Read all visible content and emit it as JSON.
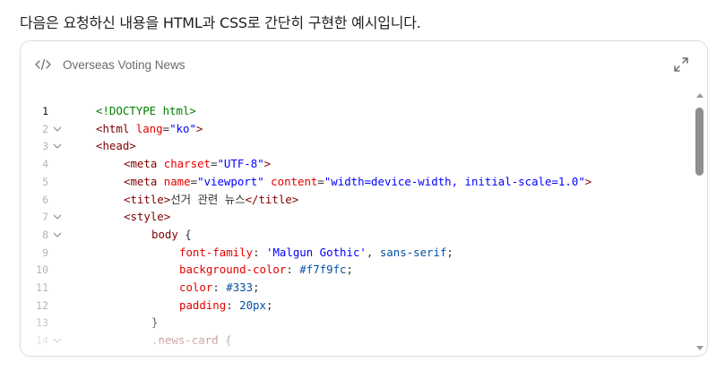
{
  "intro_text": "다음은 요청하신 내용을 HTML과 CSS로 간단히 구현한 예시입니다.",
  "artifact": {
    "title": "Overseas Voting News",
    "code_icon": "code-icon",
    "expand_icon": "expand-icon"
  },
  "code_lines": [
    {
      "n": "1",
      "fold": false,
      "active": true,
      "indent": 0,
      "tokens": [
        [
          "doctype",
          "<!DOCTYPE html>"
        ]
      ]
    },
    {
      "n": "2",
      "fold": true,
      "active": false,
      "indent": 0,
      "tokens": [
        [
          "tag",
          "<html "
        ],
        [
          "attr",
          "lang"
        ],
        [
          "punc",
          "="
        ],
        [
          "str",
          "\"ko\""
        ],
        [
          "tag",
          ">"
        ]
      ]
    },
    {
      "n": "3",
      "fold": true,
      "active": false,
      "indent": 0,
      "tokens": [
        [
          "tag",
          "<head>"
        ]
      ]
    },
    {
      "n": "4",
      "fold": false,
      "active": false,
      "indent": 1,
      "tokens": [
        [
          "tag",
          "<meta "
        ],
        [
          "attr",
          "charset"
        ],
        [
          "punc",
          "="
        ],
        [
          "str",
          "\"UTF-8\""
        ],
        [
          "tag",
          ">"
        ]
      ]
    },
    {
      "n": "5",
      "fold": false,
      "active": false,
      "indent": 1,
      "tokens": [
        [
          "tag",
          "<meta "
        ],
        [
          "attr",
          "name"
        ],
        [
          "punc",
          "="
        ],
        [
          "str",
          "\"viewport\""
        ],
        [
          "punc",
          " "
        ],
        [
          "attr",
          "content"
        ],
        [
          "punc",
          "="
        ],
        [
          "str",
          "\"width=device-width, initial-scale=1.0\""
        ],
        [
          "tag",
          ">"
        ]
      ]
    },
    {
      "n": "6",
      "fold": false,
      "active": false,
      "indent": 1,
      "tokens": [
        [
          "tag",
          "<title>"
        ],
        [
          "punc",
          "선거 관련 뉴스"
        ],
        [
          "tag",
          "</title>"
        ]
      ]
    },
    {
      "n": "7",
      "fold": true,
      "active": false,
      "indent": 1,
      "tokens": [
        [
          "tag",
          "<style>"
        ]
      ]
    },
    {
      "n": "8",
      "fold": true,
      "active": false,
      "indent": 2,
      "tokens": [
        [
          "sel",
          "body"
        ],
        [
          "punc",
          " {"
        ]
      ]
    },
    {
      "n": "9",
      "fold": false,
      "active": false,
      "indent": 3,
      "tokens": [
        [
          "prop",
          "font-family"
        ],
        [
          "punc",
          ": "
        ],
        [
          "str",
          "'Malgun Gothic'"
        ],
        [
          "punc",
          ", "
        ],
        [
          "cssval",
          "sans-serif"
        ],
        [
          "punc",
          ";"
        ]
      ]
    },
    {
      "n": "10",
      "fold": false,
      "active": false,
      "indent": 3,
      "tokens": [
        [
          "prop",
          "background-color"
        ],
        [
          "punc",
          ": "
        ],
        [
          "cssval",
          "#f7f9fc"
        ],
        [
          "punc",
          ";"
        ]
      ]
    },
    {
      "n": "11",
      "fold": false,
      "active": false,
      "indent": 3,
      "tokens": [
        [
          "prop",
          "color"
        ],
        [
          "punc",
          ": "
        ],
        [
          "cssval",
          "#333"
        ],
        [
          "punc",
          ";"
        ]
      ]
    },
    {
      "n": "12",
      "fold": false,
      "active": false,
      "indent": 3,
      "tokens": [
        [
          "prop",
          "padding"
        ],
        [
          "punc",
          ": "
        ],
        [
          "cssval",
          "20px"
        ],
        [
          "punc",
          ";"
        ]
      ]
    },
    {
      "n": "13",
      "fold": false,
      "active": false,
      "indent": 2,
      "tokens": [
        [
          "punc",
          "}"
        ]
      ]
    },
    {
      "n": "14",
      "fold": true,
      "active": false,
      "indent": 2,
      "tokens": [
        [
          "sel",
          ".news-card"
        ],
        [
          "punc",
          " {"
        ]
      ]
    }
  ]
}
